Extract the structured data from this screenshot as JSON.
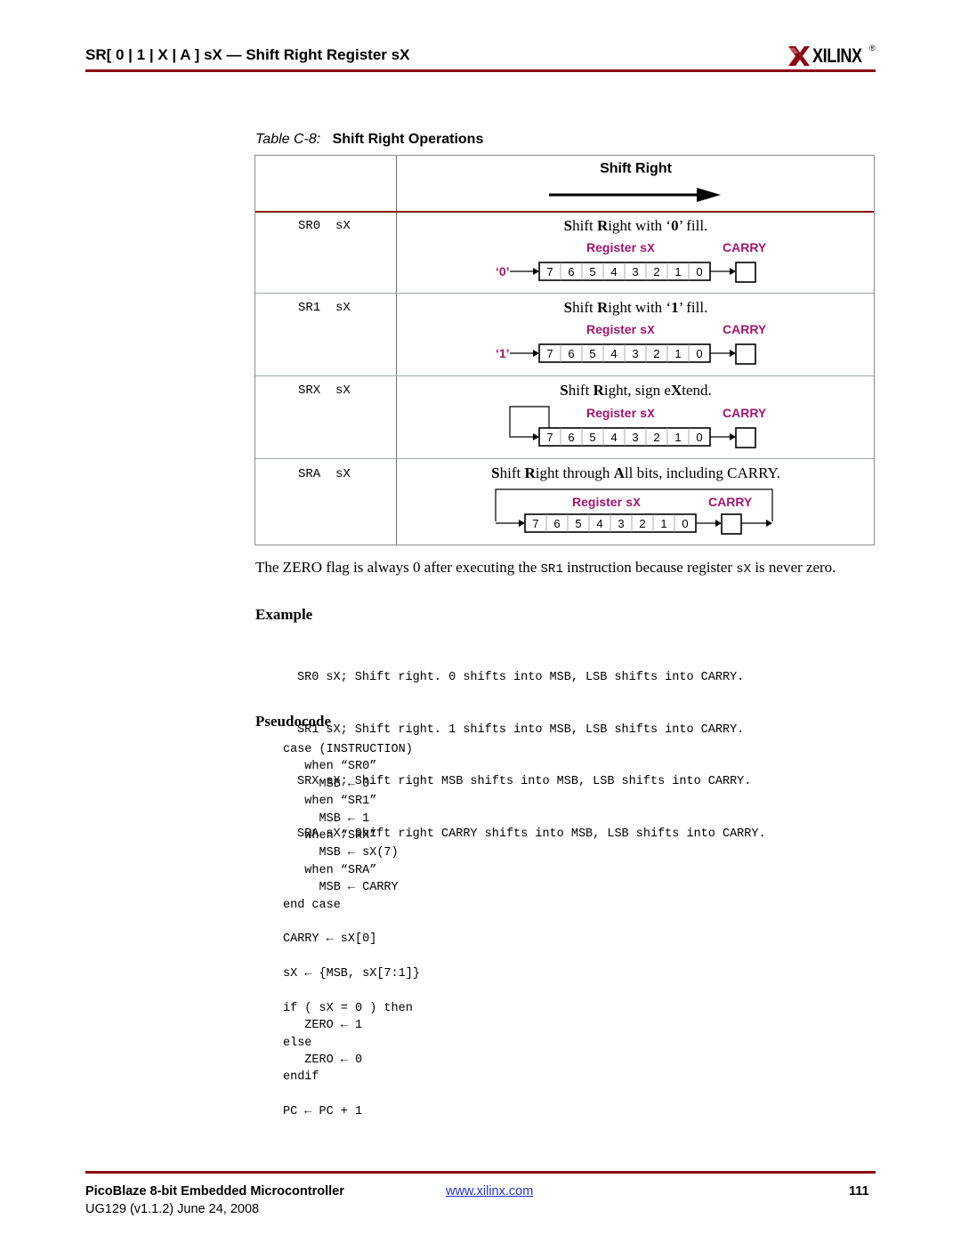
{
  "header": {
    "title": "SR[ 0 | 1 | X | A ] sX — Shift Right Register sX",
    "logo_text": "XILINX",
    "logo_reg": "®",
    "rule_color": "#8b0a14"
  },
  "table": {
    "caption_label": "Table C-8:",
    "caption_title": "Shift Right Operations",
    "column_header": "Shift Right",
    "register_label": "Register",
    "register_name": "sX",
    "carry_label": "CARRY",
    "bits": [
      "7",
      "6",
      "5",
      "4",
      "3",
      "2",
      "1",
      "0"
    ],
    "label_color": "#a0166e",
    "rows": [
      {
        "instruction": "SR0  sX",
        "desc_parts": [
          "S",
          "hift ",
          "R",
          "ight with ‘",
          "0",
          "’ fill."
        ],
        "fill_input": "‘0’"
      },
      {
        "instruction": "SR1  sX",
        "desc_parts": [
          "S",
          "hift ",
          "R",
          "ight with ‘",
          "1",
          "’ fill."
        ],
        "fill_input": "‘1’"
      },
      {
        "instruction": "SRX  sX",
        "desc_parts": [
          "S",
          "hift ",
          "R",
          "ight, sign e",
          "X",
          "tend."
        ]
      },
      {
        "instruction": "SRA  sX",
        "desc_parts": [
          "S",
          "hift ",
          "R",
          "ight through ",
          "A",
          "ll bits, including CARRY."
        ]
      }
    ]
  },
  "note": {
    "part1": "The ZERO flag is always 0 after executing the ",
    "code1": "SR1",
    "part2": " instruction because register ",
    "code2": "sX",
    "part3": " is never zero."
  },
  "example": {
    "heading": "Example",
    "lines": [
      "SR0 sX; Shift right. 0 shifts into MSB, LSB shifts into CARRY.",
      "SR1 sX; Shift right. 1 shifts into MSB, LSB shifts into CARRY.",
      "SRX sX; Shift right MSB shifts into MSB, LSB shifts into CARRY.",
      "SRA sX; Shift right CARRY shifts into MSB, LSB shifts into CARRY."
    ]
  },
  "pseudocode": {
    "heading": "Pseudocode",
    "lines": [
      "case (INSTRUCTION)",
      "   when “SR0”",
      "     MSB 🡐 0",
      "   when “SR1”",
      "     MSB 🡐 1",
      "   when “SRX”",
      "     MSB 🡐 sX(7)",
      "   when “SRA”",
      "     MSB 🡐 CARRY",
      "end case",
      "",
      "CARRY 🡐 sX[0]",
      "",
      "sX 🡐 {MSB, sX[7:1]}",
      "",
      "if ( sX = 0 ) then",
      "   ZERO 🡐 1",
      "else",
      "   ZERO 🡐 0",
      "endif",
      "",
      "PC 🡐 PC + 1"
    ]
  },
  "footer": {
    "title": "PicoBlaze 8-bit Embedded Microcontroller",
    "subtitle": "UG129 (v1.1.2) June 24, 2008",
    "url": "www.xilinx.com",
    "page_number": "111"
  }
}
